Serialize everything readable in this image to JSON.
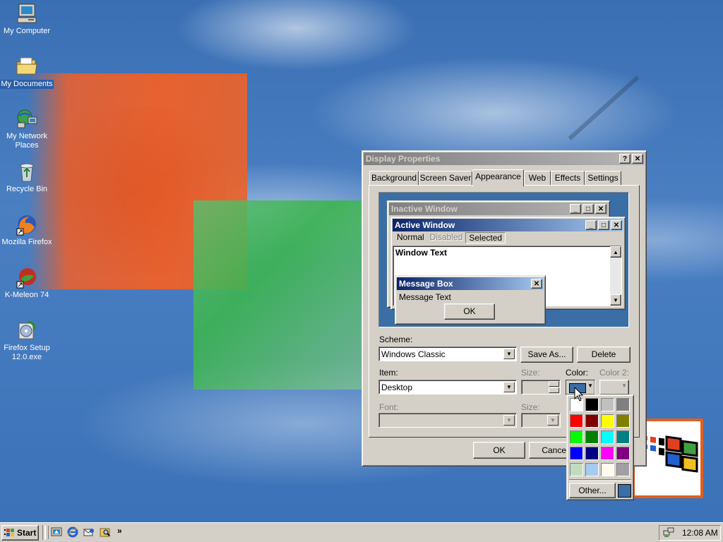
{
  "desktop": {
    "icons": [
      {
        "label": "My Computer"
      },
      {
        "label": "My Documents"
      },
      {
        "label": "My Network Places"
      },
      {
        "label": "Recycle Bin"
      },
      {
        "label": "Mozilla Firefox"
      },
      {
        "label": "K-Meleon 74"
      },
      {
        "label": "Firefox Setup 12.0.exe"
      }
    ]
  },
  "dialog": {
    "title": "Display Properties",
    "help_glyph": "?",
    "close_glyph": "✕",
    "tabs": [
      "Background",
      "Screen Saver",
      "Appearance",
      "Web",
      "Effects",
      "Settings"
    ],
    "active_tab": "Appearance",
    "preview": {
      "inactive_title": "Inactive Window",
      "active_title": "Active Window",
      "menu_normal": "Normal",
      "menu_disabled": "Disabled",
      "menu_selected": "Selected",
      "window_text": "Window Text",
      "msgbox_title": "Message Box",
      "msgbox_text": "Message Text",
      "msgbox_ok": "OK"
    },
    "scheme_label": "Scheme:",
    "scheme_value": "Windows Classic",
    "save_as": "Save As...",
    "delete": "Delete",
    "item_label": "Item:",
    "item_value": "Desktop",
    "size_label": "Size:",
    "color_label": "Color:",
    "color2_label": "Color 2:",
    "font_label": "Font:",
    "font_size_label": "Size:",
    "ok": "OK",
    "cancel": "Cancel",
    "selected_color": "#3a6ea5"
  },
  "color_picker": {
    "colors": [
      "#ffffff",
      "#000000",
      "#c0c0c0",
      "#808080",
      "#ff0000",
      "#800000",
      "#ffff00",
      "#808000",
      "#00ff00",
      "#008000",
      "#00ffff",
      "#008080",
      "#0000ff",
      "#000080",
      "#ff00ff",
      "#800080",
      "#c0dcc0",
      "#a6caf0",
      "#fffbf0",
      "#a0a0a4"
    ],
    "other_label": "Other...",
    "current": "#3a6ea5"
  },
  "taskbar": {
    "start_label": "Start",
    "chevron": "»",
    "clock": "12:08 AM"
  }
}
